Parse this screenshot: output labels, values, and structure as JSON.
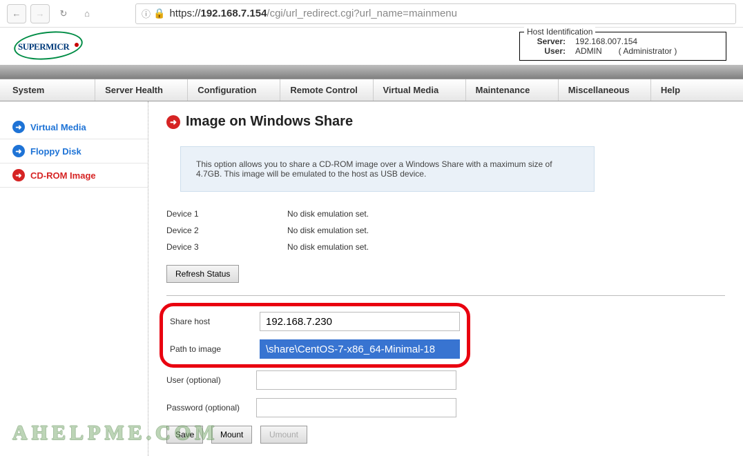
{
  "browser": {
    "url_prefix": "https://",
    "url_host": "192.168.7.154",
    "url_rest": "/cgi/url_redirect.cgi?url_name=mainmenu"
  },
  "logo_text": "SUPERMICR",
  "hostid": {
    "title": "Host Identification",
    "server_label": "Server:",
    "server_value": "192.168.007.154",
    "user_label": "User:",
    "user_value": "ADMIN",
    "user_role": "( Administrator )"
  },
  "menu": {
    "system": "System",
    "server_health": "Server Health",
    "configuration": "Configuration",
    "remote_control": "Remote Control",
    "virtual_media": "Virtual Media",
    "maintenance": "Maintenance",
    "misc": "Miscellaneous",
    "help": "Help"
  },
  "sidebar": {
    "virtual_media": "Virtual Media",
    "floppy": "Floppy Disk",
    "cdrom": "CD-ROM Image"
  },
  "page": {
    "title": "Image on Windows Share",
    "info": "This option allows you to share a CD-ROM image over a Windows Share with a maximum size of 4.7GB. This image will be emulated to the host as USB device.",
    "devices": [
      {
        "label": "Device 1",
        "status": "No disk emulation set."
      },
      {
        "label": "Device 2",
        "status": "No disk emulation set."
      },
      {
        "label": "Device 3",
        "status": "No disk emulation set."
      }
    ],
    "refresh_btn": "Refresh Status",
    "form": {
      "share_host_label": "Share host",
      "share_host_value": "192.168.7.230",
      "path_label": "Path to image",
      "path_value": "\\share\\CentOS-7-x86_64-Minimal-18",
      "user_label": "User (optional)",
      "user_value": "",
      "pass_label": "Password (optional)",
      "pass_value": ""
    },
    "buttons": {
      "save": "Save",
      "mount": "Mount",
      "umount": "Umount"
    }
  },
  "watermark": "AHELPME.COM"
}
